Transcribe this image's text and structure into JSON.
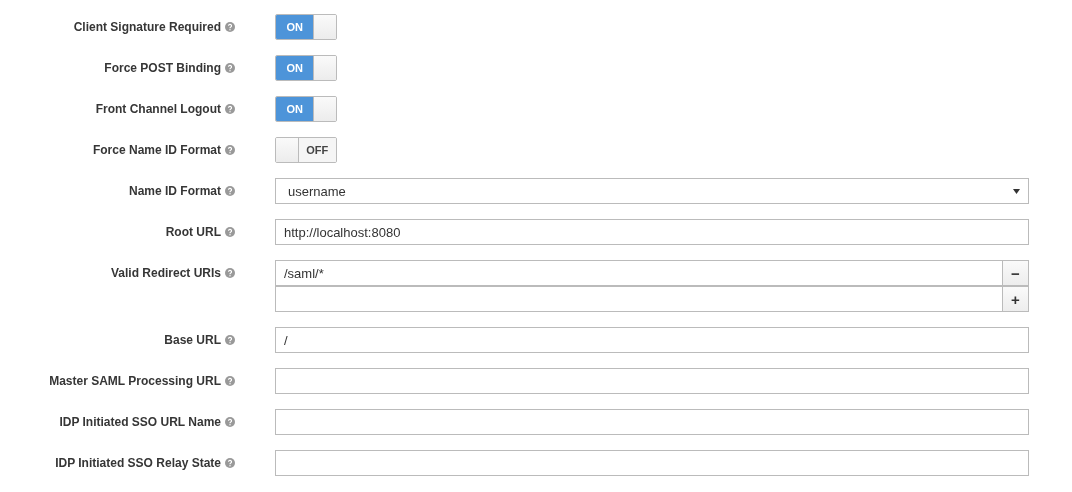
{
  "fields": [
    {
      "kind": "toggle",
      "label": "Client Signature Required",
      "on": true,
      "text": "ON"
    },
    {
      "kind": "toggle",
      "label": "Force POST Binding",
      "on": true,
      "text": "ON"
    },
    {
      "kind": "toggle",
      "label": "Front Channel Logout",
      "on": true,
      "text": "ON"
    },
    {
      "kind": "toggle",
      "label": "Force Name ID Format",
      "on": false,
      "text": "OFF"
    },
    {
      "kind": "select",
      "label": "Name ID Format",
      "value": "username"
    },
    {
      "kind": "text",
      "label": "Root URL",
      "value": "http://localhost:8080"
    },
    {
      "kind": "multi",
      "label": "Valid Redirect URIs",
      "entries": [
        {
          "value": "/saml/*",
          "button": "−"
        },
        {
          "button": "+"
        }
      ]
    },
    {
      "kind": "text",
      "label": "Base URL",
      "value": "/"
    },
    {
      "kind": "text",
      "label": "Master SAML Processing URL"
    },
    {
      "kind": "text",
      "label": "IDP Initiated SSO URL Name"
    },
    {
      "kind": "text",
      "label": "IDP Initiated SSO Relay State"
    }
  ]
}
